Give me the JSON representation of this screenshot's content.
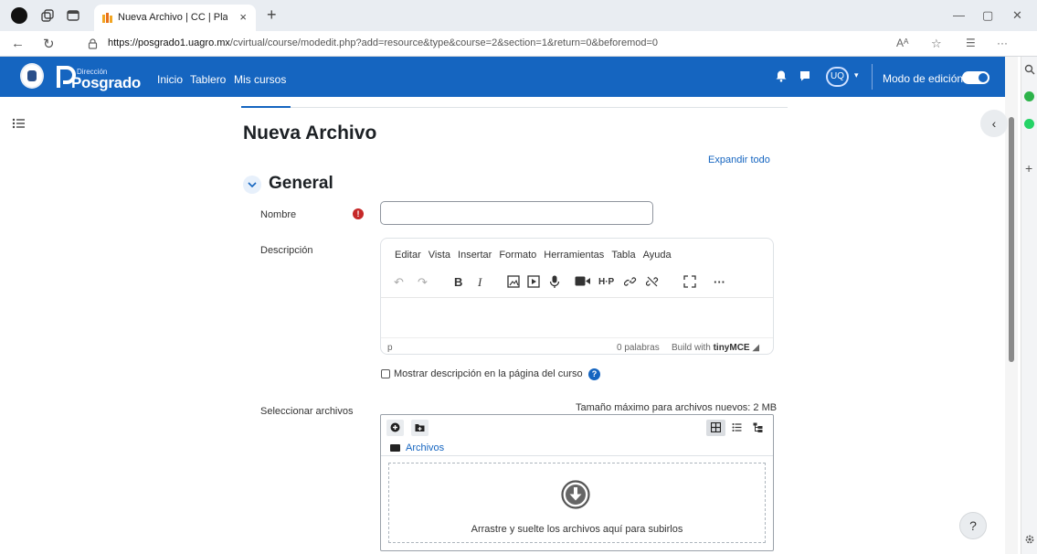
{
  "browser": {
    "tab_title": "Nueva Archivo | CC | Plataforma v",
    "tab_close": "×",
    "new_tab": "+",
    "url_host": "https://posgrado1.uagro.mx",
    "url_path": "/cvirtual/course/modedit.php?add=resource&type&course=2&section=1&return=0&beforemod=0",
    "min": "—",
    "restore": "▢",
    "close": "✕",
    "reader": "Aᴬ",
    "more": "···"
  },
  "navbar": {
    "logo_small": "Dirección",
    "logo_big": "Posgrado",
    "links": [
      "Inicio",
      "Tablero",
      "Mis cursos"
    ],
    "avatar": "UQ",
    "edit_mode": "Modo de edición",
    "brand_color": "#1565c0"
  },
  "page": {
    "title": "Nueva Archivo",
    "expand_all": "Expandir todo",
    "section": "General",
    "name_label": "Nombre",
    "req_mark": "!",
    "desc_label": "Descripción",
    "editor": {
      "menus": [
        "Editar",
        "Vista",
        "Insertar",
        "Formato",
        "Herramientas",
        "Tabla",
        "Ayuda"
      ],
      "element_path": "p",
      "words": "0 palabras",
      "build_with": "Build with",
      "brand": "tinyMCE"
    },
    "show_desc": "Mostrar descripción en la página del curso",
    "help_mark": "?",
    "select_files_label": "Seleccionar archivos",
    "max_size": "Tamaño máximo para archivos nuevos: 2 MB",
    "file_path": "Archivos",
    "drop_text": "Arrastre y suelte los archivos aquí para subirlos",
    "float_help": "?",
    "right_toggle": "‹"
  }
}
